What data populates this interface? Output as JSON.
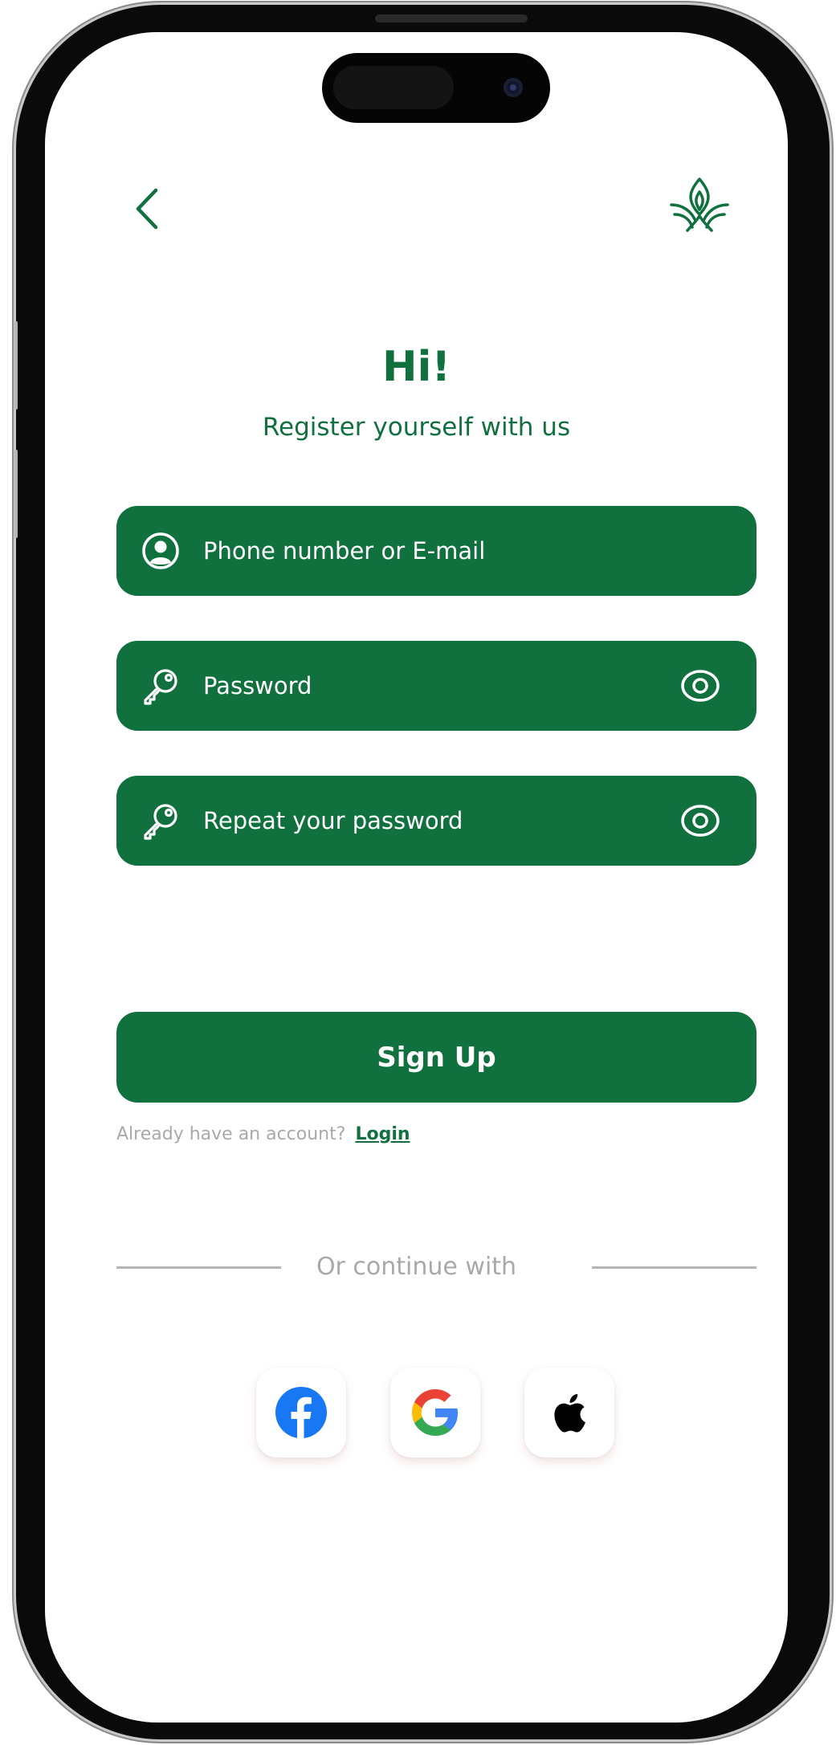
{
  "header": {
    "back_icon": "chevron-left-icon",
    "logo_icon": "leaf-lotus-logo"
  },
  "welcome": {
    "title": "Hi!",
    "subtitle": "Register yourself with us"
  },
  "form": {
    "identifier": {
      "placeholder": "Phone number or E-mail",
      "icon": "user-circle-icon"
    },
    "password": {
      "placeholder": "Password",
      "icon": "key-icon",
      "toggle_icon": "eye-icon"
    },
    "repeat_password": {
      "placeholder": "Repeat your password",
      "icon": "key-icon",
      "toggle_icon": "eye-icon"
    }
  },
  "actions": {
    "signup_label": "Sign Up",
    "login_prompt": "Already have an account?",
    "login_link": "Login"
  },
  "social": {
    "divider_text": "Or continue with",
    "providers": [
      {
        "name": "facebook",
        "icon": "facebook-icon"
      },
      {
        "name": "google",
        "icon": "google-icon"
      },
      {
        "name": "apple",
        "icon": "apple-icon"
      }
    ]
  },
  "colors": {
    "primary": "#11713e",
    "muted": "#a9a9a9",
    "background": "#ffffff",
    "facebook": "#1877f2"
  }
}
